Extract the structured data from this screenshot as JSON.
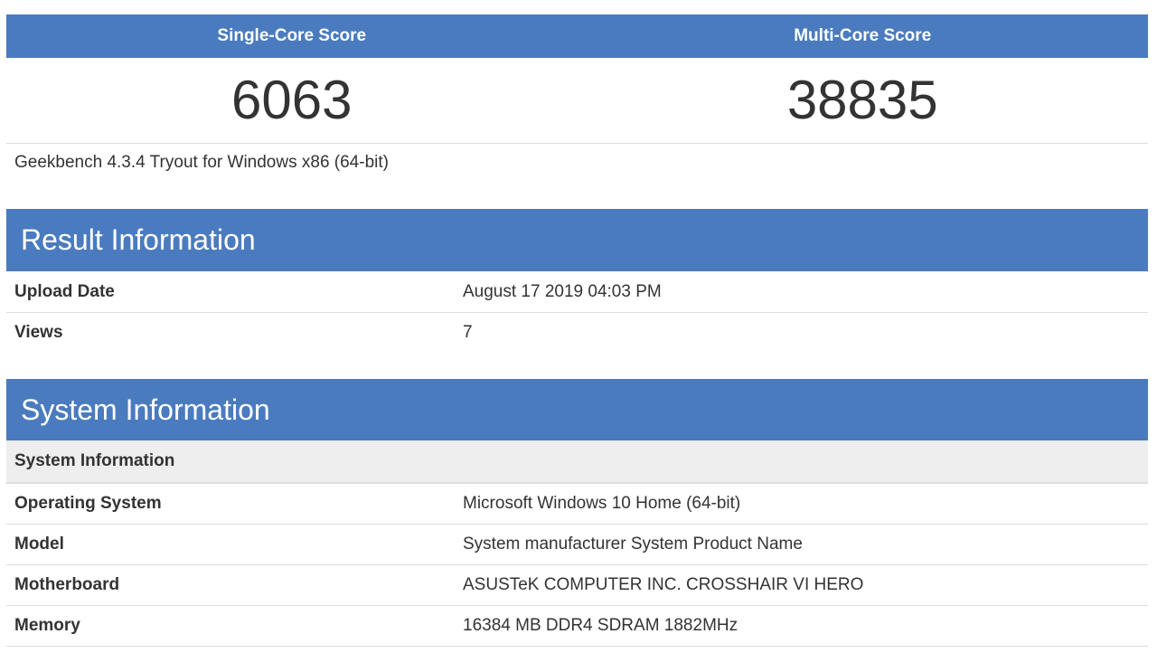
{
  "scores": {
    "single_label": "Single-Core Score",
    "multi_label": "Multi-Core Score",
    "single_value": "6063",
    "multi_value": "38835"
  },
  "version": "Geekbench 4.3.4 Tryout for Windows x86 (64-bit)",
  "result_info": {
    "title": "Result Information",
    "rows": [
      {
        "key": "Upload Date",
        "value": "August 17 2019 04:03 PM"
      },
      {
        "key": "Views",
        "value": "7"
      }
    ]
  },
  "system_info": {
    "title": "System Information",
    "subheading": "System Information",
    "rows": [
      {
        "key": "Operating System",
        "value": "Microsoft Windows 10 Home (64-bit)"
      },
      {
        "key": "Model",
        "value": "System manufacturer System Product Name"
      },
      {
        "key": "Motherboard",
        "value": "ASUSTeK COMPUTER INC. CROSSHAIR VI HERO"
      },
      {
        "key": "Memory",
        "value": "16384 MB DDR4 SDRAM 1882MHz"
      }
    ]
  },
  "colors": {
    "header_blue": "#4a7bbf",
    "subheader_gray": "#eeeeee",
    "row_border": "#dddddd",
    "text": "#333333"
  }
}
